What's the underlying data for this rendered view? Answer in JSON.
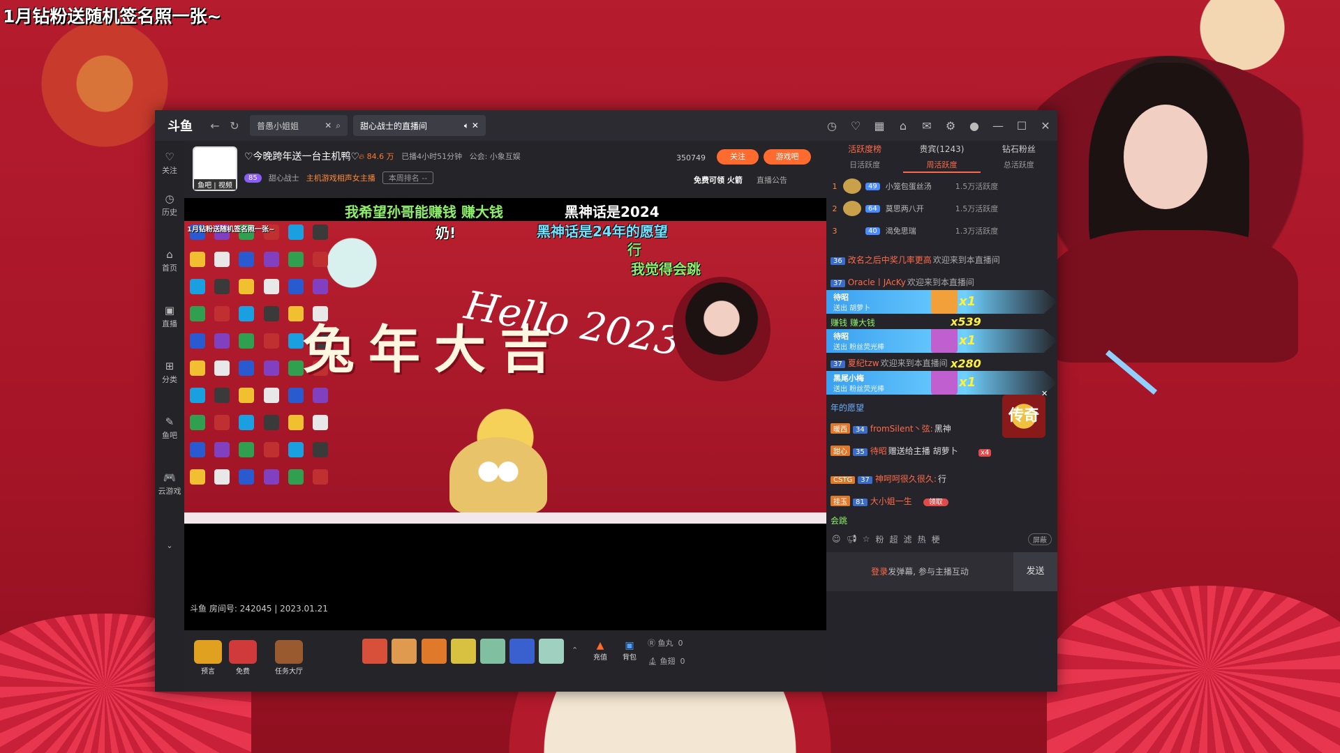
{
  "overlay_title": "1月钻粉送随机签名照一张~",
  "app": {
    "logo": "斗鱼",
    "search_tab": "普愚小姐姐",
    "active_tab": "甜心战士的直播间",
    "icons": [
      "history-icon",
      "heart-icon",
      "calendar-icon",
      "shirt-icon",
      "message-icon",
      "settings-icon"
    ]
  },
  "leftnav": [
    {
      "icon": "♡",
      "label": "关注"
    },
    {
      "icon": "◷",
      "label": "历史"
    },
    {
      "icon": "⌂",
      "label": "首页"
    },
    {
      "icon": "▣",
      "label": "直播"
    },
    {
      "icon": "⊞",
      "label": "分类"
    },
    {
      "icon": "✎",
      "label": "鱼吧"
    },
    {
      "icon": "🎮",
      "label": "云游戏"
    }
  ],
  "room": {
    "avatar_tag": "鱼吧 | 视频",
    "title": "♡今晚跨年送一台主机鸭♡",
    "heat": "84.6 万",
    "live_time": "已播4小时51分钟",
    "guild": "公会: 小象互娱",
    "level": "85",
    "streamer": "甜心战士",
    "game_tag": "主机游戏相声女主播",
    "rank": "本周排名 --",
    "fans": "350749",
    "follow": "关注",
    "game_bar": "游戏吧",
    "free_fire": "免费可领  火箭",
    "notice": "直播公告"
  },
  "video": {
    "mini_title": "1月钻粉送随机签名照一张~",
    "big_text": "兔年大吉",
    "hello": "Hello 2023",
    "footer": "斗鱼 房间号: 242045 | 2023.01.21"
  },
  "danmaku": [
    {
      "text": "我希望孙哥能赚钱  赚大钱",
      "color": "green"
    },
    {
      "text": "黑神话是2024",
      "color": "white"
    },
    {
      "text": "奶!",
      "color": "white"
    },
    {
      "text": "黑神话是24年的愿望",
      "color": "cyan"
    },
    {
      "text": "行",
      "color": "green"
    },
    {
      "text": "我觉得会跳",
      "color": "green"
    }
  ],
  "bottom": {
    "items": [
      {
        "label": "预言"
      },
      {
        "label": "免费"
      },
      {
        "label": "任务大厅"
      }
    ],
    "recharge": "充值",
    "backpack": "背包",
    "fish_ball_label": "鱼丸",
    "fish_ball": "0",
    "fish_fin_label": "鱼翅",
    "fish_fin": "0"
  },
  "panel": {
    "tabs": [
      "活跃度榜",
      "贵宾(1243)",
      "钻石粉丝"
    ],
    "subtabs": [
      "日活跃度",
      "周活跃度",
      "总活跃度"
    ],
    "ranks": [
      {
        "n": "1",
        "lv": "49",
        "name": "小笼包蛋丝汤",
        "val": "1.5万活跃度"
      },
      {
        "n": "2",
        "lv": "64",
        "name": "莫思两八开",
        "val": "1.5万活跃度"
      },
      {
        "n": "3",
        "lv": "40",
        "name": "渴免思瑞",
        "val": "1.3万活跃度"
      }
    ],
    "chat": [
      {
        "lv": "36",
        "user": "改名之后中奖几率更高",
        "text": "欢迎来到本直播间"
      },
      {
        "lv": "37",
        "user": "Oracle丨JAcKy",
        "text": "欢迎来到本直播间"
      },
      {
        "lv": "",
        "user": "",
        "text": "赚钱 赚大钱"
      },
      {
        "lv": "37",
        "user": "夏纪tzw",
        "text": "欢迎来到本直播间"
      },
      {
        "lv": "",
        "user": "",
        "text": "年的愿望"
      },
      {
        "lv": "34",
        "badge": "暖西",
        "user": "fromSilent丶弦:",
        "text": "黑神"
      },
      {
        "lv": "35",
        "badge": "甜心",
        "user": "待昭",
        "text": "赠送给主播  胡萝卜"
      },
      {
        "lv": "37",
        "badge": "CSTG",
        "user": "神呵呵很久很久:",
        "text": "行"
      },
      {
        "lv": "81",
        "badge": "挂玉",
        "user": "大小姐一生",
        "text": ""
      },
      {
        "lv": "",
        "user": "",
        "text": "会跳"
      }
    ],
    "gift_bars": [
      {
        "who": "待昭",
        "what": "送出  胡萝卜",
        "count": "x1"
      },
      {
        "who": "待昭",
        "what": "送出  粉丝荧光棒",
        "count": "x1"
      },
      {
        "who": "黑尾小梅",
        "what": "送出  粉丝荧光棒",
        "count": "x1"
      }
    ],
    "combos": [
      "x539",
      "x280"
    ],
    "ad_text": "传奇",
    "ad_badge": "x4",
    "claim": "领取",
    "block_toggle": "屏蔽",
    "input_login": "登录",
    "input_text": "发弹幕, 参与主播互动",
    "send": "发送"
  }
}
